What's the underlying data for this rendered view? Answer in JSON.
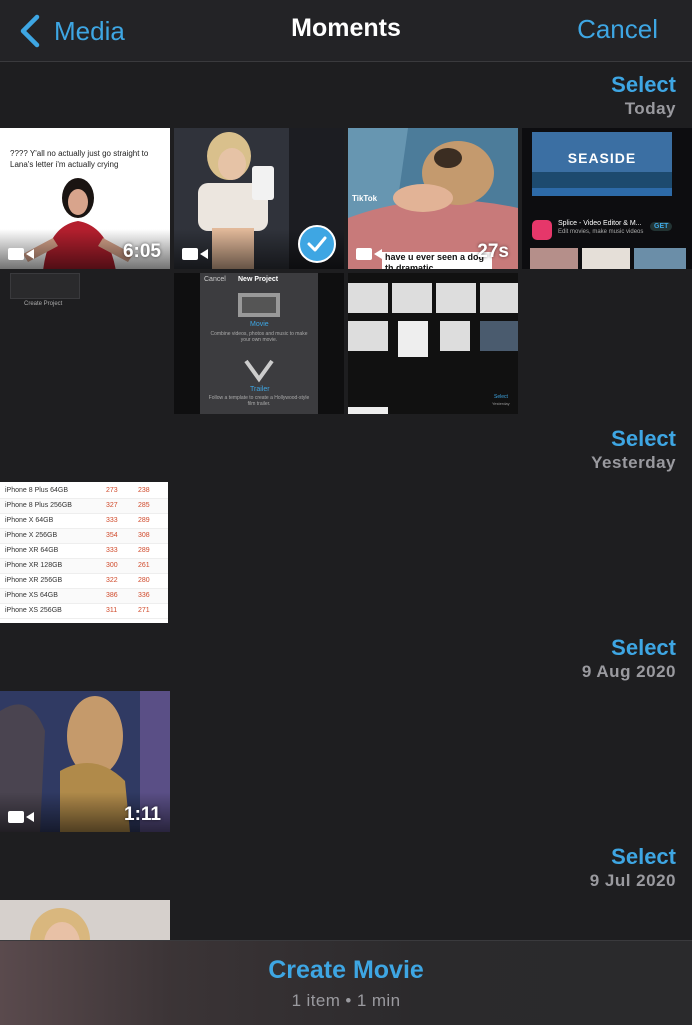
{
  "nav": {
    "back_label": "Media",
    "title": "Moments",
    "cancel_label": "Cancel"
  },
  "sections": [
    {
      "select_label": "Select",
      "date": "Today"
    },
    {
      "select_label": "Select",
      "date": "Yesterday"
    },
    {
      "select_label": "Select",
      "date": "9 Aug 2020"
    },
    {
      "select_label": "Select",
      "date": "9 Jul 2020"
    }
  ],
  "thumbs": {
    "t1": {
      "caption": "???? Y'all no actually just go straight to Lana's letter i'm actually crying",
      "duration": "6:05"
    },
    "t2": {
      "duration": "",
      "selected": true
    },
    "t3": {
      "duration": "27s",
      "overlay_text": "have u ever seen a dog th dramatic",
      "watermark": "TikTok"
    },
    "t4": {
      "banner": "SEASIDE",
      "app_name": "Splice - Video Editor & M...",
      "app_sub": "Edit movies, make music videos",
      "get": "GET"
    },
    "t5": {
      "label": "Create Project"
    },
    "t6": {
      "cancel": "Cancel",
      "title": "New Project",
      "movie": "Movie",
      "movie_desc": "Combine videos, photos and music to make your own movie.",
      "trailer": "Trailer",
      "trailer_desc": "Follow a template to create a Hollywood-style film trailer."
    },
    "t7": {
      "select": "Select",
      "date": "Yesterday"
    },
    "t9": {
      "duration": "1:11"
    }
  },
  "price_table": [
    [
      "iPhone 8 Plus 64GB",
      "273",
      "238"
    ],
    [
      "iPhone 8 Plus 256GB",
      "327",
      "285"
    ],
    [
      "iPhone X 64GB",
      "333",
      "289"
    ],
    [
      "iPhone X 256GB",
      "354",
      "308"
    ],
    [
      "iPhone XR 64GB",
      "333",
      "289"
    ],
    [
      "iPhone XR 128GB",
      "300",
      "261"
    ],
    [
      "iPhone XR 256GB",
      "322",
      "280"
    ],
    [
      "iPhone XS 64GB",
      "386",
      "336"
    ],
    [
      "iPhone XS 256GB",
      "311",
      "271"
    ]
  ],
  "bottom": {
    "create_label": "Create Movie",
    "info": "1 item • 1 min"
  },
  "colors": {
    "accent": "#3ea6e3",
    "background": "#1e1e20",
    "secondary_text": "#9a9a9f"
  }
}
